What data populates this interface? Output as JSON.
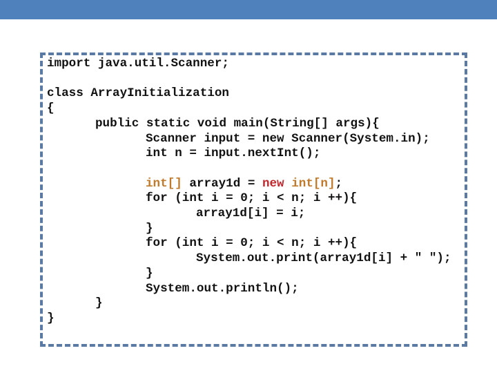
{
  "slide": {
    "header_color": "#4f81bd",
    "border_color": "#5a7aa3"
  },
  "code": {
    "language": "java",
    "colors": {
      "default": "#111111",
      "type_highlight": "#c07a2c",
      "new_highlight": "#c0272d"
    },
    "lines": [
      {
        "indent": 0,
        "text": "import java.util.Scanner;"
      },
      {
        "indent": 0,
        "text": ""
      },
      {
        "indent": 0,
        "text": "class ArrayInitialization"
      },
      {
        "indent": 0,
        "text": "{"
      },
      {
        "indent": 1,
        "text": "public static void main(String[] args){"
      },
      {
        "indent": 2,
        "text": "Scanner input = new Scanner(System.in);"
      },
      {
        "indent": 2,
        "text": "int n = input.nextInt();"
      },
      {
        "indent": 0,
        "text": ""
      },
      {
        "indent": 2,
        "segments": [
          {
            "text": "int[]",
            "style": "type"
          },
          {
            "text": " array1d = ",
            "style": "plain"
          },
          {
            "text": "new",
            "style": "new"
          },
          {
            "text": " ",
            "style": "plain"
          },
          {
            "text": "int[n]",
            "style": "type"
          },
          {
            "text": ";",
            "style": "plain"
          }
        ]
      },
      {
        "indent": 2,
        "text": "for (int i = 0; i < n; i ++){"
      },
      {
        "indent": 3,
        "text": "array1d[i] = i;"
      },
      {
        "indent": 2,
        "text": "}"
      },
      {
        "indent": 2,
        "text": "for (int i = 0; i < n; i ++){"
      },
      {
        "indent": 3,
        "text": "System.out.print(array1d[i] + \" \");"
      },
      {
        "indent": 2,
        "text": "}"
      },
      {
        "indent": 2,
        "text": "System.out.println();"
      },
      {
        "indent": 1,
        "text": "}"
      },
      {
        "indent": 0,
        "text": "}"
      }
    ]
  }
}
